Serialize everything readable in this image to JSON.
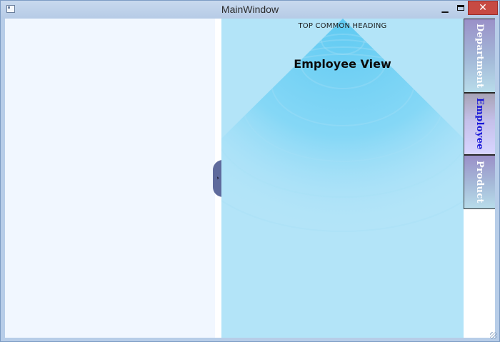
{
  "window": {
    "title": "MainWindow",
    "minimize_glyph": "▁",
    "close_glyph": "✕"
  },
  "collapse_handle": {
    "glyph": "›"
  },
  "main": {
    "top_heading": "TOP COMMON HEADING",
    "view_title": "Employee View"
  },
  "tabs": [
    {
      "label": "Department",
      "selected": false
    },
    {
      "label": "Employee",
      "selected": true
    },
    {
      "label": "Product",
      "selected": false
    }
  ],
  "colors": {
    "main_background": "#b3e4f8",
    "spotlight": "#5fcaf2",
    "left_panel": "#f1f7ff",
    "selected_tab_text": "#1a18d8",
    "close_button": "#c74a43"
  }
}
